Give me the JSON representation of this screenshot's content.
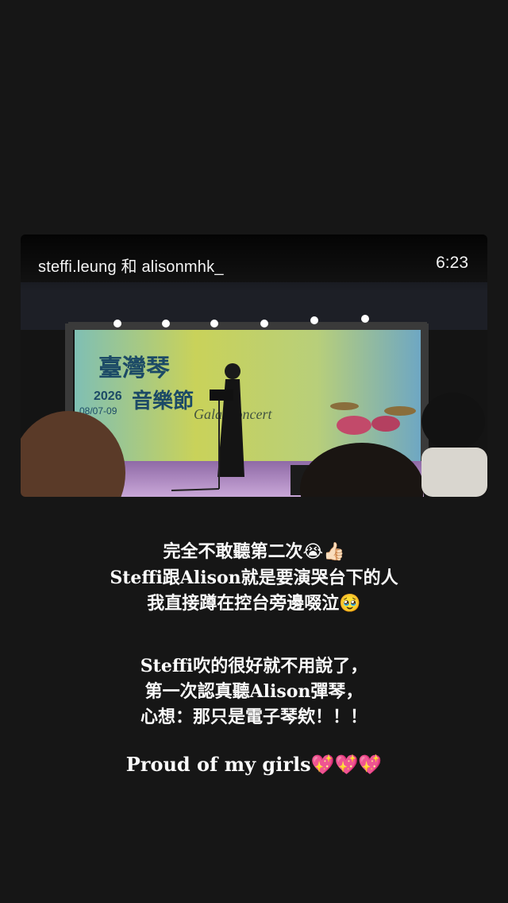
{
  "story_card": {
    "author": "steffi.leung 和 alisonmhk_",
    "duration": "6:23",
    "poster": {
      "title_main": "臺灣琴",
      "title_sub": "音樂節",
      "year": "2026",
      "dates": "08/07-09",
      "event": "Gala Concert"
    }
  },
  "caption": {
    "block1": [
      {
        "text": "完全不敢聽第二次",
        "emoji": "😭👍🏻"
      },
      {
        "text": "Steffi跟Alison就是要演哭台下的人",
        "emoji": ""
      },
      {
        "text": "我直接蹲在控台旁邊啜泣",
        "emoji": "🥹"
      }
    ],
    "block2": [
      {
        "text": "Steffi吹的很好就不用說了，",
        "emoji": ""
      },
      {
        "text": "第一次認真聽Alison彈琴，",
        "emoji": ""
      },
      {
        "text": "心想：那只是電子琴欸！！！",
        "emoji": ""
      }
    ],
    "block3": [
      {
        "text": "Proud of my girls",
        "emoji": "💖💖💖"
      }
    ]
  },
  "colors": {
    "background": "#161616",
    "banner_yellow": "#d8cf52",
    "banner_teal": "#6fb7b0",
    "stage_floor": "#b79ac9"
  }
}
